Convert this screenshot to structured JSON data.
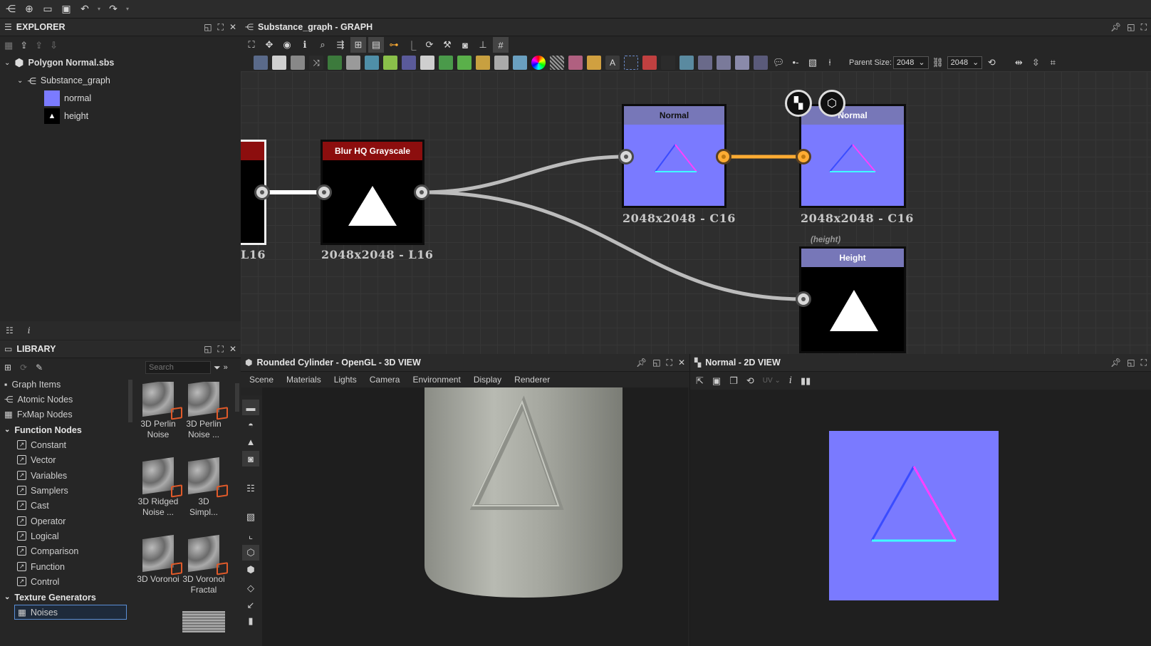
{
  "explorer": {
    "title": "EXPLORER",
    "package": "Polygon Normal.sbs",
    "graph": "Substance_graph",
    "outputs": [
      {
        "label": "normal",
        "color": "#7b7bff"
      },
      {
        "label": "height",
        "color": "#000000"
      }
    ]
  },
  "library": {
    "title": "LIBRARY",
    "search_placeholder": "Search",
    "categories": [
      {
        "label": "Graph Items"
      },
      {
        "label": "Atomic Nodes"
      },
      {
        "label": "FxMap Nodes"
      }
    ],
    "function_nodes_label": "Function Nodes",
    "function_items": [
      "Constant",
      "Vector",
      "Variables",
      "Samplers",
      "Cast",
      "Operator",
      "Logical",
      "Comparison",
      "Function",
      "Control"
    ],
    "texture_generators_label": "Texture Generators",
    "selected_item": "Noises",
    "thumbnails": [
      {
        "line1": "3D Perlin",
        "line2": "Noise"
      },
      {
        "line1": "3D Perlin",
        "line2": "Noise ..."
      },
      {
        "line1": "3D Ridged",
        "line2": "Noise ..."
      },
      {
        "line1": "3D",
        "line2": "Simpl..."
      },
      {
        "line1": "3D Voronoi",
        "line2": ""
      },
      {
        "line1": "3D Voronoi",
        "line2": "Fractal"
      }
    ]
  },
  "graph_panel": {
    "title": "Substance_graph - GRAPH",
    "parent_size_label": "Parent Size:",
    "parent_size_value": "2048",
    "size_value2": "2048",
    "nodes": {
      "left_res": "L16",
      "blur_title": "Blur HQ Grayscale",
      "blur_res": "2048x2048 - L16",
      "normal1_title": "Normal",
      "normal1_res": "2048x2048 - C16",
      "normal2_title": "Normal",
      "normal2_res": "2048x2048 - C16",
      "height_comment": "(height)",
      "height_title": "Height"
    }
  },
  "view3d": {
    "title": "Rounded Cylinder - OpenGL - 3D VIEW",
    "menu": [
      "Scene",
      "Materials",
      "Lights",
      "Camera",
      "Environment",
      "Display",
      "Renderer"
    ]
  },
  "view2d": {
    "title": "Normal - 2D VIEW",
    "uv_label": "UV"
  },
  "colors": {
    "normal_map": "#7a7aff",
    "blur_header": "#8c0e0e",
    "node_header": "#7777b8",
    "connection_active": "#ffac33"
  }
}
